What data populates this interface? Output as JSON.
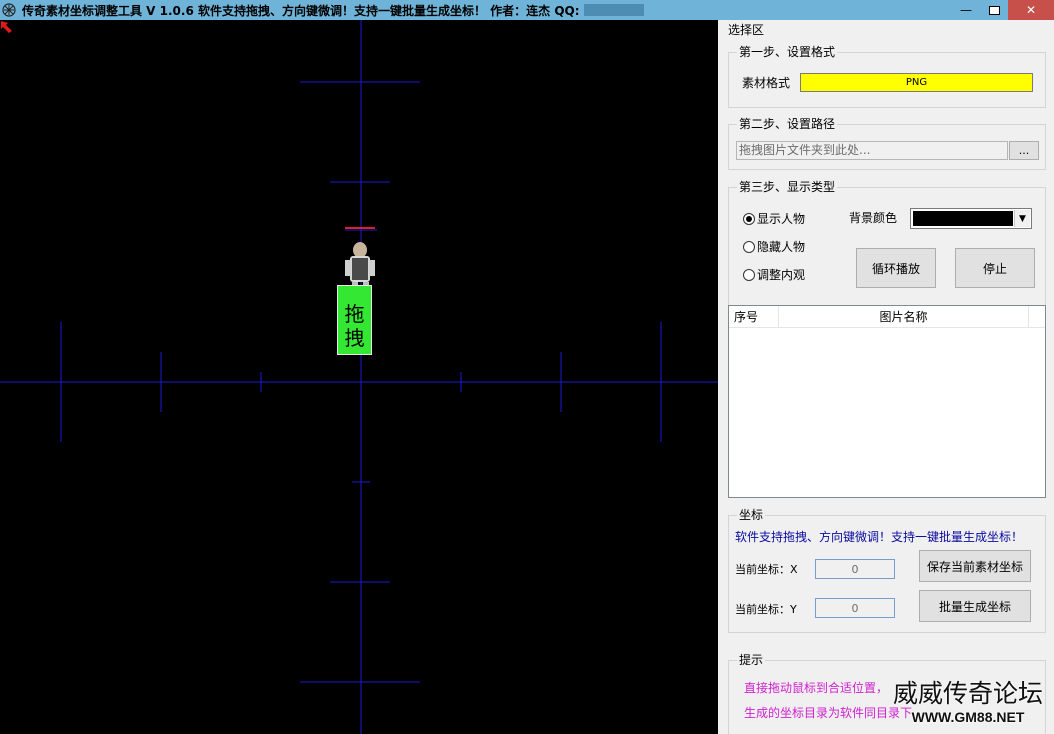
{
  "window": {
    "title": "传奇素材坐标调整工具 V 1.0.6  软件支持拖拽、方向键微调！支持一键批量生成坐标！ 作者：连杰 QQ:",
    "minimize": "—",
    "close": "✕"
  },
  "canvas": {
    "drag_line1": "拖",
    "drag_line2": "拽"
  },
  "panel": {
    "title": "选择区",
    "step1": {
      "label": "第一步、设置格式",
      "format_label": "素材格式",
      "format_value": "PNG",
      "format_color": "#ffff00"
    },
    "step2": {
      "label": "第二步、设置路径",
      "path_placeholder": "拖拽图片文件夹到此处...",
      "browse": "..."
    },
    "step3": {
      "label": "第三步、显示类型",
      "radios": [
        "显示人物",
        "隐藏人物",
        "调整内观"
      ],
      "selected": "显示人物",
      "bg_label": "背景颜色",
      "bg_color": "#000000",
      "loop_button": "循环播放",
      "stop_button": "停止"
    },
    "table": {
      "columns": [
        "序号",
        "图片名称"
      ],
      "rows": []
    },
    "coords": {
      "label": "坐标",
      "info": "软件支持拖拽、方向键微调！支持一键批量生成坐标！",
      "x_label": "当前坐标：X",
      "x_value": "0",
      "y_label": "当前坐标：Y",
      "y_value": "0",
      "save_button": "保存当前素材坐标",
      "batch_button": "批量生成坐标"
    },
    "tips": {
      "label": "提示",
      "line1": "直接拖动鼠标到合适位置，",
      "line2": "生成的坐标目录为软件同目录下"
    }
  },
  "watermark": {
    "line1": "威威传奇论坛",
    "line2": "WWW.GM88.NET"
  }
}
